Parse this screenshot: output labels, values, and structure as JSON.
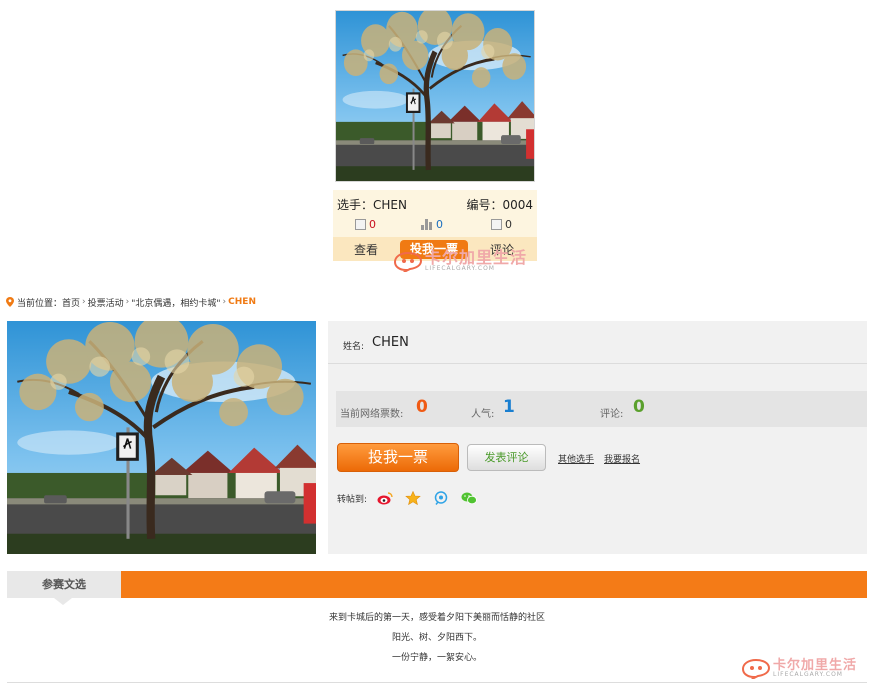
{
  "card": {
    "player_label": "选手：CHEN",
    "number_label": "编号：0004",
    "stats": [
      {
        "icon": "flag-icon",
        "value": "0",
        "color": "#c8101f"
      },
      {
        "icon": "bar-chart-icon",
        "value": "0",
        "color": "#1a6fc0"
      },
      {
        "icon": "flag-icon",
        "value": "0",
        "color": "#333333"
      }
    ],
    "actions": {
      "view": "查看",
      "vote": "投我一票",
      "comment": "评论"
    }
  },
  "logo": {
    "cn": "卡尔加里生活",
    "en": "LIFECALGARY.COM"
  },
  "breadcrumb": {
    "prefix": "当前位置：",
    "items": [
      "首页",
      "投票活动",
      "\"北京偶遇，相约卡城\""
    ],
    "current": "CHEN"
  },
  "profile": {
    "name_label": "姓名:",
    "name": "CHEN",
    "votes_label": "当前网络票数:",
    "votes": "0",
    "popularity_label": "人气:",
    "popularity": "1",
    "comments_label": "评论:",
    "comments": "0",
    "vote_button": "投我一票",
    "comment_button": "发表评论",
    "other_link": "其他选手",
    "signup_link": "我要报名",
    "share_label": "转帖到:",
    "share_icons": [
      "weibo-icon",
      "star-icon",
      "tencent-icon",
      "wechat-icon"
    ]
  },
  "article": {
    "tab": "参赛文选",
    "lines": [
      "来到卡城后的第一天，感受着夕阳下美丽而恬静的社区",
      "阳光、树、夕阳西下。",
      "一份宁静，一絮安心。"
    ]
  },
  "colors": {
    "accent": "#f47b17",
    "votes": "#f05a14",
    "popularity": "#1a7fd0",
    "comments": "#5aa02c"
  }
}
